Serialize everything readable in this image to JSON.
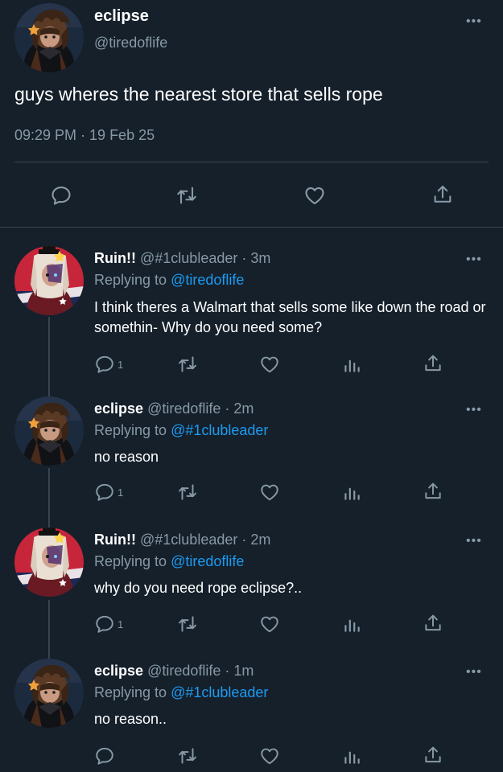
{
  "colors": {
    "background": "#15202b",
    "text": "#ffffff",
    "muted": "#8899a6",
    "link": "#1d9bf0",
    "divider": "#38444d"
  },
  "main_tweet": {
    "name": "eclipse",
    "handle": "@tiredoflife",
    "text": "guys wheres the nearest store that sells rope",
    "timestamp": "09:29 PM · 19 Feb 25",
    "more_icon": "more-dots-icon",
    "actions": [
      "reply-icon",
      "retweet-icon",
      "like-icon",
      "share-icon"
    ]
  },
  "replies": [
    {
      "name": "Ruin!!",
      "handle": "@#1clubleader",
      "time": "· 3m",
      "replying_prefix": "Replying to",
      "replying_to": "@tiredoflife",
      "text": "I think theres a Walmart that sells some like down the road or somethin- Why do you need some?",
      "reply_count": "1"
    },
    {
      "name": "eclipse",
      "handle": "@tiredoflife",
      "time": "· 2m",
      "replying_prefix": "Replying to",
      "replying_to": "@#1clubleader",
      "text": "no reason",
      "reply_count": "1"
    },
    {
      "name": "Ruin!!",
      "handle": "@#1clubleader",
      "time": "· 2m",
      "replying_prefix": "Replying to",
      "replying_to": "@tiredoflife",
      "text": "why do you need rope eclipse?..",
      "reply_count": "1"
    },
    {
      "name": "eclipse",
      "handle": "@tiredoflife",
      "time": "· 1m",
      "replying_prefix": "Replying to",
      "replying_to": "@#1clubleader",
      "text": "no reason..",
      "reply_count": ""
    }
  ]
}
